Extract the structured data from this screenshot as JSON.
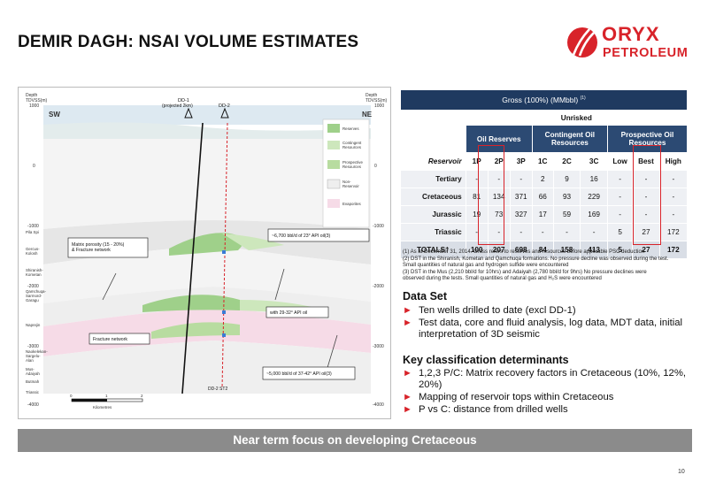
{
  "slide": {
    "title": "DEMIR DAGH: NSAI VOLUME ESTIMATES",
    "page": "10"
  },
  "logo": {
    "word1": "ORYX",
    "word2": "PETROLEUM",
    "icon": "oryx-horns-logo-icon",
    "color": "#d8232a"
  },
  "diagram": {
    "depth_left_label": "Depth\nTDVSS(m)",
    "depth_right_label": "Depth\nTDVSS(m)",
    "sw": "SW",
    "ne": "NE",
    "depths_left": [
      "1000",
      "0",
      "-1000",
      "-2000",
      "-3000",
      "-4000"
    ],
    "depths_right": [
      "1000",
      "0",
      "-1000",
      "-2000",
      "-3000",
      "-4000"
    ],
    "wells": {
      "dd1": "DD-1",
      "dd1_sub": "(projected 2km)",
      "dd2": "DD-2",
      "dd2st2": "DD-2 ST2"
    },
    "formations": [
      "Pila Spi",
      "Gercus-\nKolosh",
      "Shiranish-\nKometan",
      "Qamchuqa-\nSarmord-\nGaragu",
      "Naprejin",
      "Naokelekan-\nSargelu-\nAlan",
      "Mus-\nAdaiyah",
      "Butmah",
      "Triassic"
    ],
    "callouts": {
      "matrix": "Matrix porosity (15 - 20%)\n& Fracture network",
      "oil23": "~6,700 bbl/d of 23° API oil(3)",
      "api2932": "with 29-32° API oil",
      "fracture": "Fracture network",
      "oil3742": "~5,000 bbl/d of 37-42° API oil(3)"
    },
    "legend": [
      "Reserves",
      "Contingent\nResources",
      "Prospective\nResources",
      "Non-\nReservoir",
      "Evaporites"
    ],
    "scale": {
      "labels": [
        "0",
        "1",
        "2"
      ],
      "unit": "Kilometres"
    }
  },
  "table": {
    "title": "Gross (100%) (MMbbl)",
    "title_sup": "(1)",
    "unrisked": "Unrisked",
    "groups": [
      "Oil Reserves",
      "Contingent Oil\nResources",
      "Prospective Oil\nResources"
    ],
    "header_label": "Reservoir",
    "columns": [
      "1P",
      "2P",
      "3P",
      "1C",
      "2C",
      "3C",
      "Low",
      "Best",
      "High"
    ],
    "rows": [
      {
        "label": "Tertiary",
        "values": [
          "-",
          "-",
          "-",
          "2",
          "9",
          "16",
          "-",
          "-",
          "-"
        ]
      },
      {
        "label": "Cretaceous",
        "values": [
          "81",
          "134",
          "371",
          "66",
          "93",
          "229",
          "-",
          "-",
          "-"
        ]
      },
      {
        "label": "Jurassic",
        "values": [
          "19",
          "73",
          "327",
          "17",
          "59",
          "169",
          "-",
          "-",
          "-"
        ]
      },
      {
        "label": "Triassic",
        "values": [
          "-",
          "-",
          "-",
          "-",
          "-",
          "-",
          "5",
          "27",
          "172"
        ]
      }
    ],
    "totals": {
      "label": "TOTALS†",
      "values": [
        "100",
        "207",
        "698",
        "84",
        "158",
        "413",
        "5",
        "27",
        "172"
      ]
    },
    "highlight_color": "#d8232a"
  },
  "notes": [
    "(1)  As at December 31, 2014. Gross refers to reserves and resources before applicable PSC deduction",
    "(2)  DST in the Shiranish, Kometan and Qamchuqa formations. No pressure decline was observed during the test.",
    "       Small quantities of natural gas and hydrogen sulfide were encountered",
    "(3)  DST in the Mus (2,210 bbl/d for 10hrs) and Adaiyah (2,780 bbl/d for 9hrs) No pressure declines were",
    "       observed during the tests. Small quantities of natural gas and H₂S were encountered"
  ],
  "dataset": {
    "title": "Data Set",
    "items": [
      "Ten wells drilled to date (excl DD-1)",
      "Test data, core and fluid analysis, log data, MDT data, initial interpretation of 3D seismic"
    ]
  },
  "keyclass": {
    "title": "Key classification determinants",
    "items": [
      "1,2,3 P/C: Matrix recovery factors in Cretaceous (10%, 12%, 20%)",
      "Mapping of reservoir tops within Cretaceous",
      "P vs C: distance from drilled wells"
    ]
  },
  "banner": "Near term focus on developing Cretaceous"
}
